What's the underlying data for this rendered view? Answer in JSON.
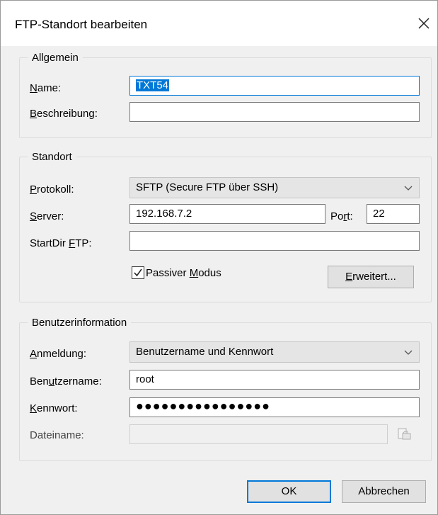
{
  "window": {
    "title": "FTP-Standort bearbeiten",
    "close_icon": "close-icon"
  },
  "allgemein": {
    "legend": "Allgemein",
    "name_label_u": "N",
    "name_label_rest": "ame:",
    "name_value": "TXT54",
    "desc_label_u": "B",
    "desc_label_rest": "eschreibung:",
    "desc_value": ""
  },
  "standort": {
    "legend": "Standort",
    "protokoll_label_u": "P",
    "protokoll_label_rest": "rotokoll:",
    "protokoll_value": "SFTP (Secure FTP über SSH)",
    "server_label_u": "S",
    "server_label_rest": "erver:",
    "server_value": "192.168.7.2",
    "port_label_pre": "Po",
    "port_label_u": "r",
    "port_label_rest": "t:",
    "port_value": "22",
    "startdir_label_pre": "StartDir ",
    "startdir_label_u": "F",
    "startdir_label_rest": "TP:",
    "startdir_value": "",
    "passive_label_pre": "Passiver ",
    "passive_label_u": "M",
    "passive_label_rest": "odus",
    "passive_checked": true,
    "advanced_label_u": "E",
    "advanced_label_rest": "rweitert..."
  },
  "benutzer": {
    "legend": "Benutzerinformation",
    "anmeldung_label_u": "A",
    "anmeldung_label_rest": "nmeldung:",
    "anmeldung_value": "Benutzername und Kennwort",
    "username_label_pre": "Ben",
    "username_label_u": "u",
    "username_label_rest": "tzername:",
    "username_value": "root",
    "password_label_u": "K",
    "password_label_rest": "ennwort:",
    "password_value": "●●●●●●●●●●●●●●●●",
    "filename_label": "Dateiname:",
    "filename_value": ""
  },
  "buttons": {
    "ok": "OK",
    "cancel": "Abbrechen"
  }
}
